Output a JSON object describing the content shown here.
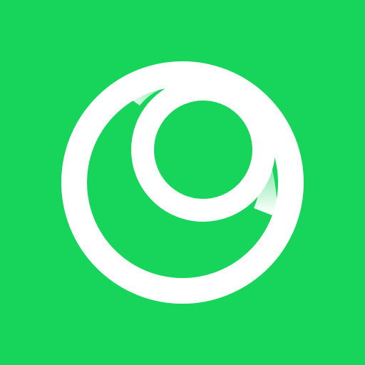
{
  "app_icon": {
    "icon_name": "concentric-rings-logo-icon",
    "colors": {
      "background": "#16d55a",
      "ring": "#ffffff"
    }
  }
}
